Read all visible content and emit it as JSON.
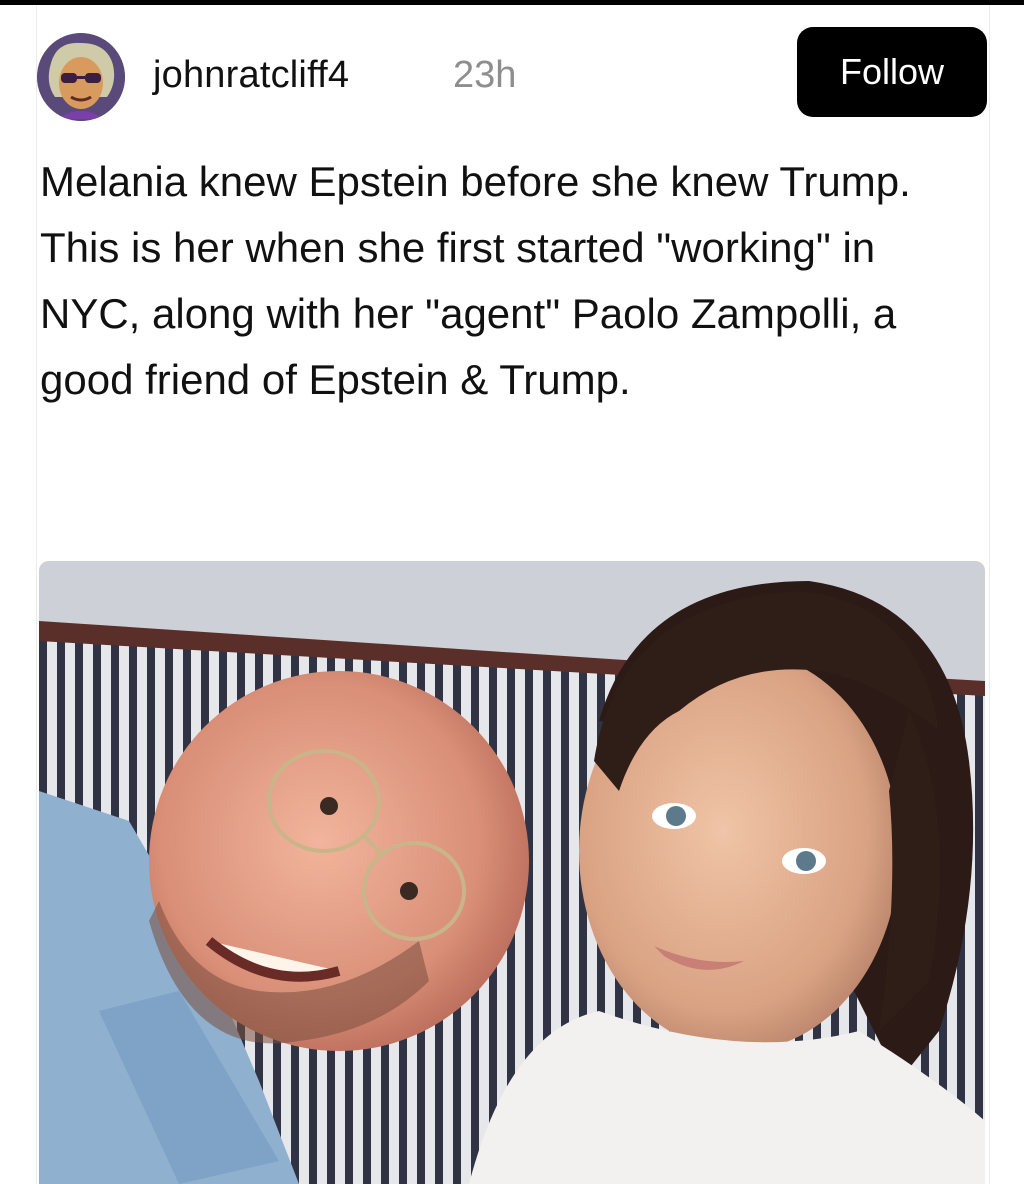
{
  "post": {
    "author": {
      "username": "johnratcliff4",
      "timestamp": "23h",
      "avatar_icon": "avatar-portrait-icon"
    },
    "follow_label": "Follow",
    "caption": {
      "paragraph_1": "Melania knew Epstein before she knew Trump.",
      "paragraph_2": "This is her when she first started \"working\" in NYC, along with her \"agent\" Paolo Zampolli, a good friend of Epstein & Trump."
    },
    "photo": {
      "subject": "photo of a smiling man with glasses and a dark-haired woman on a striped couch"
    }
  },
  "colors": {
    "follow_button_bg": "#000000",
    "follow_button_text": "#ffffff",
    "timestamp": "#8e8e8e",
    "text": "#111111"
  }
}
